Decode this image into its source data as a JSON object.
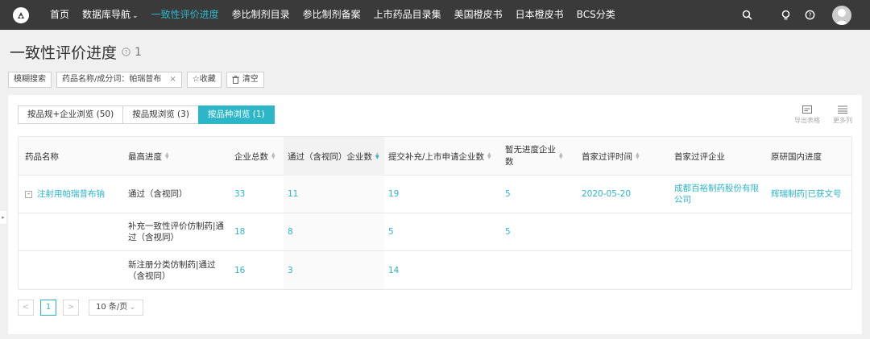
{
  "nav": {
    "items": [
      {
        "label": "首页",
        "active": false
      },
      {
        "label": "数据库导航",
        "active": false,
        "caret": "⌄"
      },
      {
        "label": "一致性评价进度",
        "active": true
      },
      {
        "label": "参比制剂目录",
        "active": false
      },
      {
        "label": "参比制剂备案",
        "active": false
      },
      {
        "label": "上市药品目录集",
        "active": false
      },
      {
        "label": "美国橙皮书",
        "active": false
      },
      {
        "label": "日本橙皮书",
        "active": false
      },
      {
        "label": "BCS分类",
        "active": false
      }
    ],
    "icons": [
      "search-icon",
      "bulb-icon",
      "help-icon",
      "avatar"
    ]
  },
  "page": {
    "title": "一致性评价进度",
    "count": "1"
  },
  "filters": {
    "fuzzy_search": "模糊搜索",
    "tag_label": "药品名称/成分词：帕瑞昔布",
    "tag_close": "×",
    "favorite": "☆收藏",
    "clear": "清空"
  },
  "tabs": [
    {
      "label": "按品规+企业浏览 (50)",
      "active": false
    },
    {
      "label": "按品规浏览 (3)",
      "active": false
    },
    {
      "label": "按品种浏览 (1)",
      "active": true
    }
  ],
  "tools": {
    "export": "导出表格",
    "more_columns": "更多列"
  },
  "table": {
    "headers": {
      "drug_name": "药品名称",
      "max_progress": "最高进度",
      "total_companies": "企业总数",
      "passed": "通过（含视同）企业数",
      "submitted": "提交补充/上市申请企业数",
      "no_progress_1": "暂无进度企业",
      "no_progress_2": "数",
      "first_pass_time": "首家过评时间",
      "first_pass_company": "首家过评企业",
      "original_progress": "原研国内进度"
    },
    "rows": [
      {
        "expand": "-",
        "drug_name": "注射用帕瑞昔布钠",
        "max_progress": "通过（含视同）",
        "total": "33",
        "passed": "11",
        "submitted": "19",
        "no_progress": "5",
        "first_time": "2020-05-20",
        "first_company_1": "成都百裕制药股份有限",
        "first_company_2": "公司",
        "original": "辉瑞制药|已获文号"
      },
      {
        "progress_1": "补充一致性评价仿制药|通",
        "progress_2": "过（含视同）",
        "total": "18",
        "passed": "8",
        "submitted": "5",
        "no_progress": "5"
      },
      {
        "progress_1": "新注册分类仿制药|通过",
        "progress_2": "（含视同）",
        "total": "16",
        "passed": "3",
        "submitted": "14"
      }
    ]
  },
  "pagination": {
    "prev": "<",
    "current": "1",
    "next": ">",
    "page_size": "10 条/页",
    "caret": "⌄"
  },
  "side_toggle": "▸",
  "colors": {
    "accent": "#2cb6c8",
    "nav_bg": "#3a3a3a"
  }
}
